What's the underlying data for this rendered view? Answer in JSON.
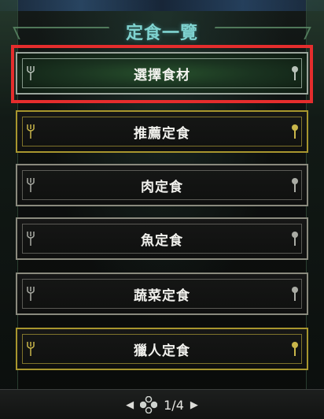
{
  "header": {
    "title": "定食一覽"
  },
  "menu": {
    "items": [
      {
        "label": "選擇食材",
        "selected": true,
        "style": "silver"
      },
      {
        "label": "推薦定食",
        "selected": false,
        "style": "gold"
      },
      {
        "label": "肉定食",
        "selected": false,
        "style": "silver"
      },
      {
        "label": "魚定食",
        "selected": false,
        "style": "silver"
      },
      {
        "label": "蔬菜定食",
        "selected": false,
        "style": "silver"
      },
      {
        "label": "獵人定食",
        "selected": false,
        "style": "gold"
      }
    ]
  },
  "pager": {
    "prev_icon": "◀",
    "next_icon": "▶",
    "page_text": "1/4"
  },
  "colors": {
    "title": "#7fd3d0",
    "cursor": "#e52d2d",
    "gold_border": "#a8962e",
    "silver_border": "#8a8a7e",
    "selected_fill": "#27502c"
  }
}
